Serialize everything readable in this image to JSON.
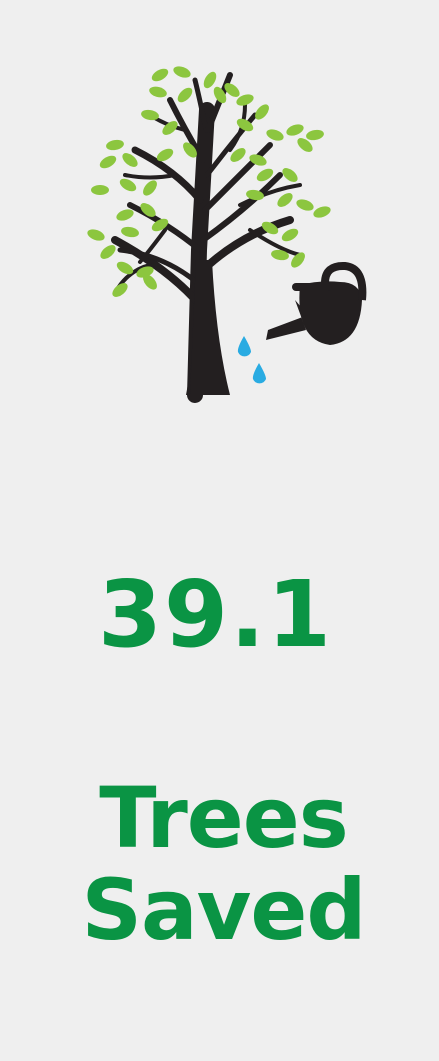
{
  "stat": {
    "value": "39.1",
    "label_line1": "Trees",
    "label_line2": "Saved"
  },
  "illustration": {
    "icon": "tree-watering-can-icon",
    "colors": {
      "leaf": "#8cc63f",
      "trunk": "#231f20",
      "water": "#29abe2",
      "text": "#0a9444",
      "background": "#efefef"
    }
  }
}
